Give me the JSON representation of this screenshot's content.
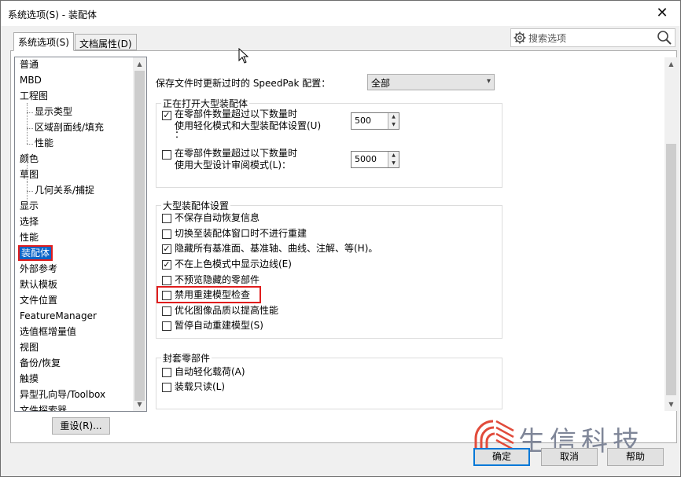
{
  "window": {
    "title": "系统选项(S) - 装配体",
    "close_glyph": "✕"
  },
  "tabs": [
    {
      "label": "系统选项(S)",
      "active": true
    },
    {
      "label": "文档属性(D)",
      "active": false
    }
  ],
  "search": {
    "placeholder": "搜索选项"
  },
  "tree": {
    "items": [
      {
        "label": "普通",
        "sub": false
      },
      {
        "label": "MBD",
        "sub": false
      },
      {
        "label": "工程图",
        "sub": false
      },
      {
        "label": "显示类型",
        "sub": true
      },
      {
        "label": "区域剖面线/填充",
        "sub": true
      },
      {
        "label": "性能",
        "sub": true
      },
      {
        "label": "颜色",
        "sub": false
      },
      {
        "label": "草图",
        "sub": false
      },
      {
        "label": "几何关系/捕捉",
        "sub": true
      },
      {
        "label": "显示",
        "sub": false
      },
      {
        "label": "选择",
        "sub": false
      },
      {
        "label": "性能",
        "sub": false
      },
      {
        "label": "装配体",
        "sub": false,
        "selected": true
      },
      {
        "label": "外部参考",
        "sub": false
      },
      {
        "label": "默认模板",
        "sub": false
      },
      {
        "label": "文件位置",
        "sub": false
      },
      {
        "label": "FeatureManager",
        "sub": false
      },
      {
        "label": "选值框增量值",
        "sub": false
      },
      {
        "label": "视图",
        "sub": false
      },
      {
        "label": "备份/恢复",
        "sub": false
      },
      {
        "label": "触摸",
        "sub": false
      },
      {
        "label": "异型孔向导/Toolbox",
        "sub": false
      },
      {
        "label": "文件探索器",
        "sub": false
      }
    ]
  },
  "reset_button": "重设(R)...",
  "speedpak": {
    "label": "保存文件时更新过时的 SpeedPak 配置：",
    "value": "全部"
  },
  "large_open": {
    "title": "正在打开大型装配体",
    "opt1": {
      "line1": "在零部件数量超过以下数量时",
      "line2": "使用轻化模式和大型装配体设置(U)",
      "line3": "：",
      "checked": true,
      "value": "500"
    },
    "opt2": {
      "line1": "在零部件数量超过以下数量时",
      "line2": "使用大型设计审阅模式(L)：",
      "checked": false,
      "value": "5000"
    }
  },
  "large_settings": {
    "title": "大型装配体设置",
    "options": [
      {
        "label": "不保存自动恢复信息",
        "checked": false
      },
      {
        "label": "切换至装配体窗口时不进行重建",
        "checked": false
      },
      {
        "label": "隐藏所有基准面、基准轴、曲线、注解、等(H)。",
        "checked": true
      },
      {
        "label": "不在上色模式中显示边线(E)",
        "checked": true
      },
      {
        "label": "不预览隐藏的零部件",
        "checked": false
      },
      {
        "label": "禁用重建模型检查",
        "checked": false
      },
      {
        "label": "优化图像品质以提高性能",
        "checked": false
      },
      {
        "label": "暂停自动重建模型(S)",
        "checked": false
      }
    ]
  },
  "envelope": {
    "title": "封套零部件",
    "options": [
      {
        "label": "自动轻化载荷(A)",
        "checked": false
      },
      {
        "label": "装载只读(L)",
        "checked": false
      }
    ]
  },
  "footer": {
    "ok": "确定",
    "cancel": "取消",
    "help": "帮助"
  },
  "watermark": {
    "text": "生信科技"
  },
  "colors": {
    "selection": "#0a64c8",
    "highlight": "#e01d1d",
    "accent": "#0078d7"
  }
}
